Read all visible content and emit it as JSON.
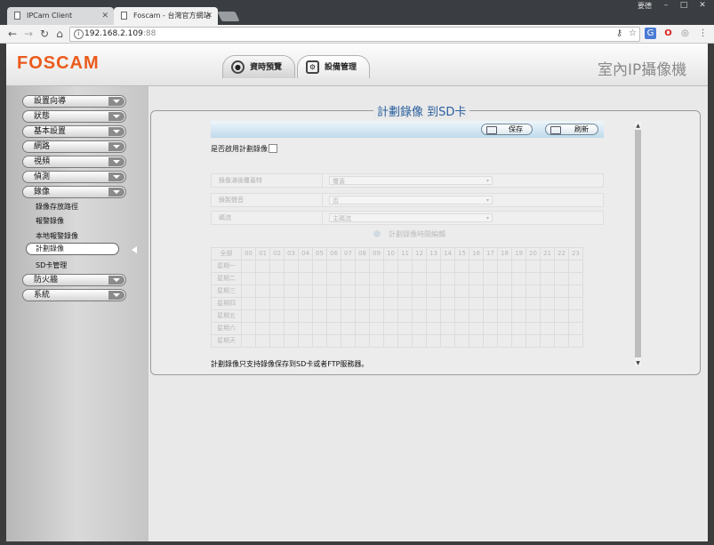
{
  "browser": {
    "tabs": [
      {
        "title": "IPCam Client"
      },
      {
        "title": "Foscam - 台灣官方網站"
      }
    ],
    "user_button": "要德",
    "url_host": "192.168.2.109",
    "url_port": ":88"
  },
  "header": {
    "logo": "FOSCAM",
    "nav": [
      {
        "label": "資時預覽",
        "icon": "camera-icon"
      },
      {
        "label": "設備管理",
        "icon": "gears-icon"
      }
    ],
    "product_title": "室內IP攝像機"
  },
  "sidebar": {
    "menus_top": [
      "設置向導",
      "狀態",
      "基本設置",
      "網路",
      "視頻",
      "偵測",
      "錄像"
    ],
    "submenu": [
      "錄像存放路徑",
      "報警錄像",
      "本地報警錄像"
    ],
    "selected": "計劃錄像",
    "submenu_after": [
      "SD卡管理"
    ],
    "menus_bottom": [
      "防火牆",
      "系統"
    ]
  },
  "content": {
    "title": "計劃錄像 到SD卡",
    "save_label": "保存",
    "refresh_label": "刷新",
    "enable_label": "是否啟用計劃錄像",
    "enable_checked": false,
    "rows": [
      {
        "label": "錄像滿後覆蓋特",
        "value": "覆蓋"
      },
      {
        "label": "錄製聲音",
        "value": "否"
      },
      {
        "label": "碼流",
        "value": "主碼流"
      }
    ],
    "schedule_edit_label": "計劃錄像時間編輯",
    "grid": {
      "all_label": "全部",
      "hours": [
        "00",
        "01",
        "02",
        "03",
        "04",
        "05",
        "06",
        "07",
        "08",
        "09",
        "10",
        "11",
        "12",
        "13",
        "14",
        "15",
        "16",
        "17",
        "18",
        "19",
        "20",
        "21",
        "22",
        "23"
      ],
      "days": [
        "星期一",
        "星期二",
        "星期三",
        "星期四",
        "星期五",
        "星期六",
        "星期天"
      ]
    },
    "note": "計劃錄像只支持錄像保存到SD卡或者FTP服務器。"
  }
}
